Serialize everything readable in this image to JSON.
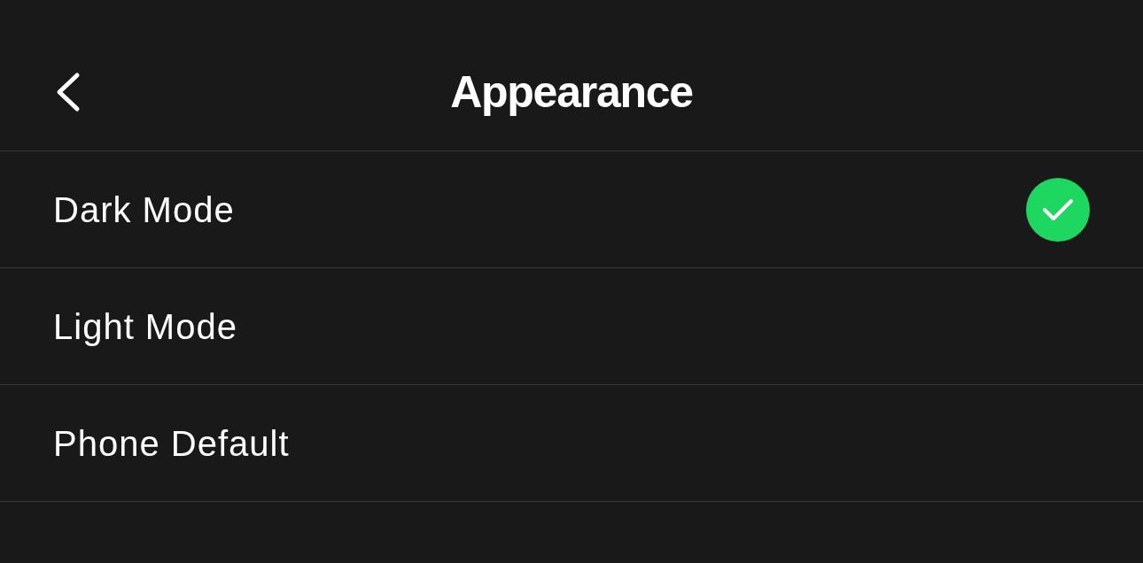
{
  "header": {
    "title": "Appearance"
  },
  "options": [
    {
      "label": "Dark Mode",
      "selected": true
    },
    {
      "label": "Light Mode",
      "selected": false
    },
    {
      "label": "Phone Default",
      "selected": false
    }
  ]
}
